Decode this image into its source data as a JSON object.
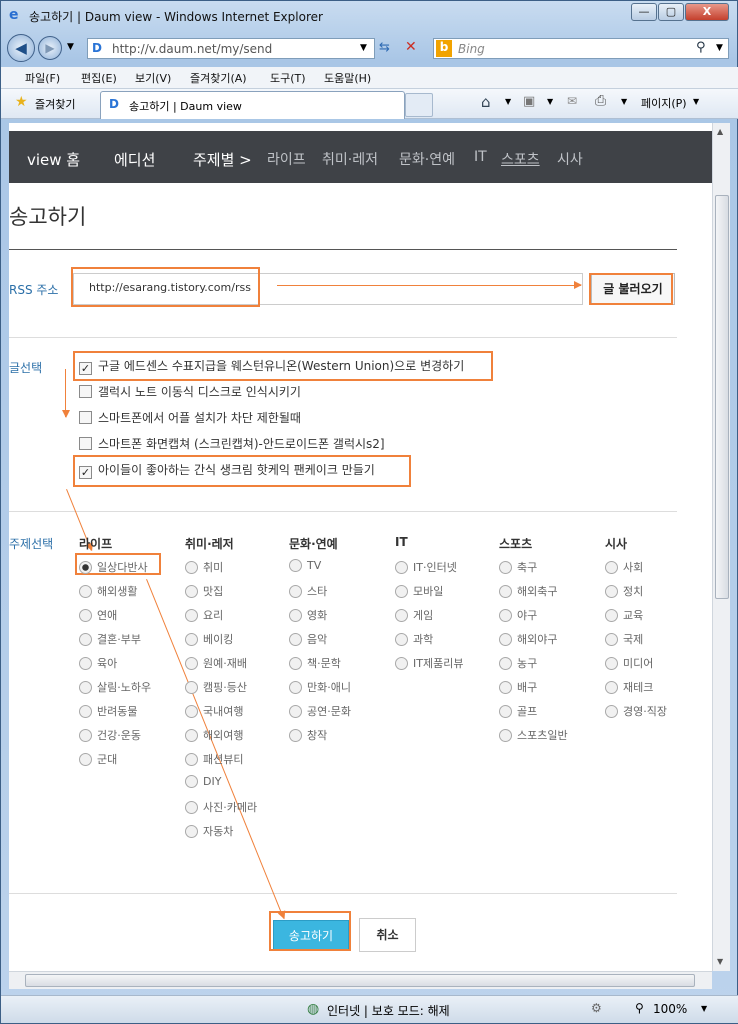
{
  "window": {
    "title": "송고하기 | Daum view - Windows Internet Explorer",
    "controls": [
      "—",
      "▢",
      "X"
    ]
  },
  "address": {
    "url": "http://v.daum.net/my/send",
    "bing_placeholder": "Bing"
  },
  "menu": [
    "파일(F)",
    "편집(E)",
    "보기(V)",
    "즐겨찾기(A)",
    "도구(T)",
    "도움말(H)"
  ],
  "favbar": {
    "favorites": "즐겨찾기",
    "tab_title": "송고하기 | Daum view",
    "page_menu": "페이지(P)"
  },
  "topnav": {
    "home": "view 홈",
    "edition": "에디션",
    "topics": "주제별 >",
    "subs": [
      "라이프",
      "취미·레저",
      "문화·연예",
      "IT",
      "스포츠",
      "시사"
    ]
  },
  "page": {
    "title": "송고하기",
    "rss_label": "RSS 주소",
    "rss_value": "http://esarang.tistory.com/rss",
    "load_button": "글 불러오기",
    "posts_label": "글선택",
    "topic_label": "주제선택",
    "submit": "송고하기",
    "cancel": "취소"
  },
  "posts": [
    {
      "label": "구글 에드센스 수표지급을 웨스턴유니온(Western Union)으로 변경하기",
      "checked": true
    },
    {
      "label": "갤럭시 노트 이동식 디스크로 인식시키기",
      "checked": false
    },
    {
      "label": "스마트폰에서 어플 설치가 차단 제한될때",
      "checked": false
    },
    {
      "label": "스마트폰 화면캡쳐 (스크린캡쳐)-안드로이드폰 갤럭시s2]",
      "checked": false
    },
    {
      "label": "아이들이 좋아하는 간식 생크림 핫케익 팬케이크 만들기",
      "checked": true
    }
  ],
  "categories": [
    {
      "name": "라이프",
      "items": [
        "일상다반사",
        "해외생활",
        "연애",
        "결혼·부부",
        "육아",
        "살림·노하우",
        "반려동물",
        "건강·운동",
        "군대"
      ]
    },
    {
      "name": "취미·레저",
      "items": [
        "취미",
        "맛집",
        "요리",
        "베이킹",
        "원예·재배",
        "캠핑·등산",
        "국내여행",
        "해외여행",
        "패션뷰티",
        "DIY",
        "사진·카메라",
        "자동차"
      ]
    },
    {
      "name": "문화·연예",
      "items": [
        "TV",
        "스타",
        "영화",
        "음악",
        "책·문학",
        "만화·애니",
        "공연·문화",
        "창작"
      ]
    },
    {
      "name": "IT",
      "items": [
        "IT·인터넷",
        "모바일",
        "게임",
        "과학",
        "IT제품리뷰"
      ]
    },
    {
      "name": "스포츠",
      "items": [
        "축구",
        "해외축구",
        "야구",
        "해외야구",
        "농구",
        "배구",
        "골프",
        "스포츠일반"
      ]
    },
    {
      "name": "시사",
      "items": [
        "사회",
        "정치",
        "교육",
        "국제",
        "미디어",
        "재테크",
        "경영·직장"
      ]
    }
  ],
  "selected_topic": "일상다반사",
  "status": {
    "zone": "인터넷 | 보호 모드: 해제",
    "zoom": "100%"
  },
  "colors": {
    "annotation": "#f0813b",
    "nav_bg": "#3f4247",
    "submit_bg": "#3bb6e0"
  }
}
